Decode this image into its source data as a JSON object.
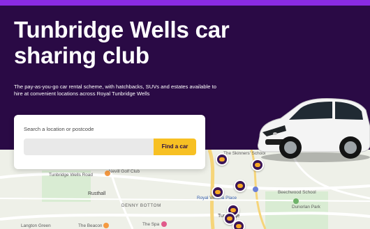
{
  "hero": {
    "title": "Tunbridge Wells car sharing club",
    "subtitle": "The pay-as-you-go car rental scheme, with hatchbacks, SUVs and estates available to hire at convenient locations across Royal Tunbridge Wells"
  },
  "search": {
    "label": "Search a location or postcode",
    "input_value": "",
    "button_label": "Find a car"
  },
  "map": {
    "labels": [
      {
        "text": "The Skinners' School",
        "style": "map-label"
      },
      {
        "text": "Tunbridge Wells Road",
        "style": "map-label"
      },
      {
        "text": "Nevill Golf Club",
        "style": "map-label"
      },
      {
        "text": "Rusthall",
        "style": "map-label bold"
      },
      {
        "text": "DENNY BOTTOM",
        "style": "map-label caps"
      },
      {
        "text": "Royal Victoria Place",
        "style": "map-label blue"
      },
      {
        "text": "Beechwood School",
        "style": "map-label"
      },
      {
        "text": "Dunorlan Park",
        "style": "map-label"
      },
      {
        "text": "Langton Green",
        "style": "map-label"
      },
      {
        "text": "The Beacon",
        "style": "map-label"
      },
      {
        "text": "The Spa",
        "style": "map-label"
      },
      {
        "text": "Tunbridge",
        "style": "map-label bold"
      }
    ]
  },
  "colors": {
    "brand_purple": "#2a0a45",
    "accent_yellow": "#f7c023",
    "top_bar": "#8a2be2"
  }
}
